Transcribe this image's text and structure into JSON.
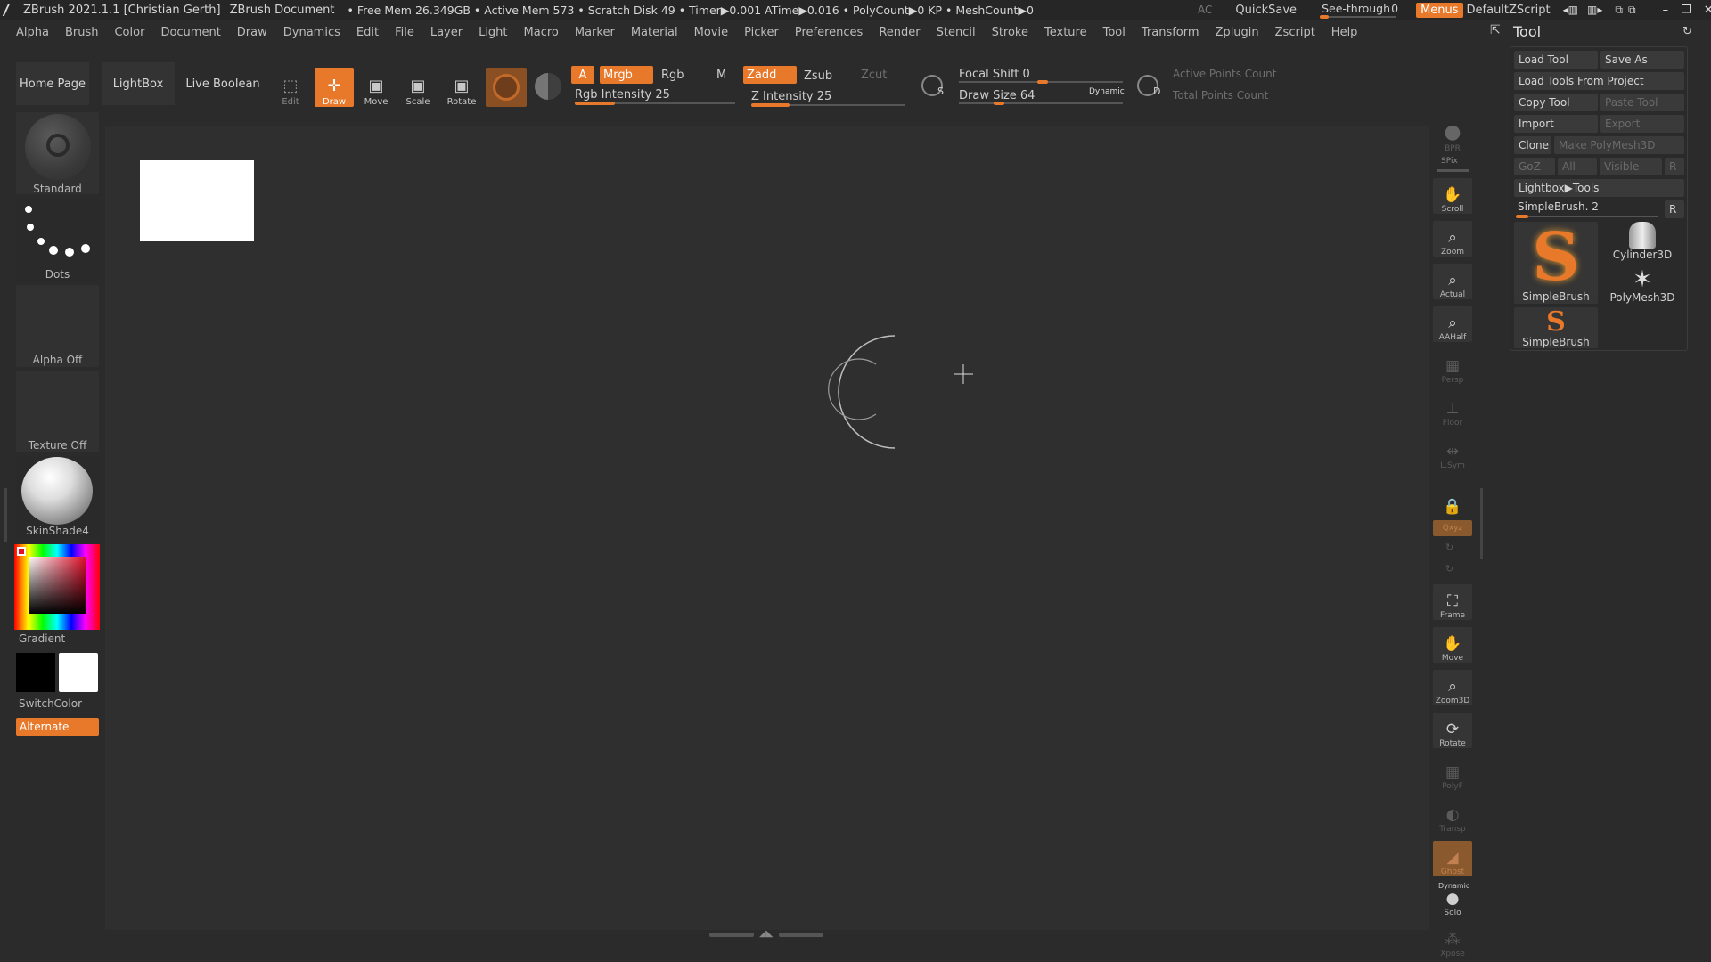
{
  "titlebar": {
    "app": "ZBrush 2021.1.1 [Christian Gerth]",
    "document": "ZBrush Document",
    "stats": "• Free Mem 26.349GB • Active Mem 573 • Scratch Disk 49 • Timer▶0.001 ATime▶0.016 • PolyCount▶0 KP • MeshCount▶0",
    "ac": "AC",
    "quicksave": "QuickSave",
    "see_through_label": "See-through",
    "see_through_value": "0",
    "see_through_level": 0,
    "menus": "Menus",
    "default_zscript": "DefaultZScript"
  },
  "menubar": {
    "items": [
      "Alpha",
      "Brush",
      "Color",
      "Document",
      "Draw",
      "Dynamics",
      "Edit",
      "File",
      "Layer",
      "Light",
      "Macro",
      "Marker",
      "Material",
      "Movie",
      "Picker",
      "Preferences",
      "Render",
      "Stencil",
      "Stroke",
      "Texture",
      "Tool",
      "Transform",
      "Zplugin",
      "Zscript",
      "Help"
    ]
  },
  "toolbar": {
    "home_page": "Home Page",
    "lightbox": "LightBox",
    "live_boolean": "Live Boolean",
    "edit": "Edit",
    "draw": "Draw",
    "move": "Move",
    "scale": "Scale",
    "rotate": "Rotate",
    "a": "A",
    "mrgb": "Mrgb",
    "rgb": "Rgb",
    "m": "M",
    "zadd": "Zadd",
    "zsub": "Zsub",
    "zcut": "Zcut",
    "rgb_intensity": "Rgb Intensity 25",
    "rgb_intensity_value": 25,
    "z_intensity": "Z Intensity 25",
    "z_intensity_value": 25,
    "focal_shift": "Focal Shift 0",
    "focal_shift_value": 0,
    "draw_size": "Draw Size 64",
    "draw_size_value": 64,
    "dynamic": "Dynamic",
    "active_points": "Active Points Count",
    "total_points": "Total Points Count",
    "s": "S",
    "d": "D"
  },
  "left_shelf": {
    "brush": "Standard",
    "stroke": "Dots",
    "alpha": "Alpha Off",
    "texture": "Texture Off",
    "material": "SkinShade4",
    "gradient": "Gradient",
    "switch_color": "SwitchColor",
    "alternate": "Alternate"
  },
  "right_shelf": {
    "bpr": "BPR",
    "spix": "SPix",
    "scroll": "Scroll",
    "zoom": "Zoom",
    "actual": "Actual",
    "aahalf": "AAHalf",
    "persp": "Persp",
    "floor": "Floor",
    "lsym": "L.Sym",
    "qxyz": "Qxyz",
    "frame": "Frame",
    "move": "Move",
    "zoom3d": "Zoom3D",
    "rotate": "Rotate",
    "polyf": "PolyF",
    "transp": "Transp",
    "ghost": "Ghost",
    "dynamic": "Dynamic",
    "solo": "Solo",
    "xpose": "Xpose"
  },
  "tool_panel": {
    "title": "Tool",
    "load_tool": "Load Tool",
    "save_as": "Save As",
    "load_from_project": "Load Tools From Project",
    "copy_tool": "Copy Tool",
    "paste_tool": "Paste Tool",
    "import": "Import",
    "export": "Export",
    "clone": "Clone",
    "make_polymesh": "Make PolyMesh3D",
    "goz": "GoZ",
    "all": "All",
    "visible": "Visible",
    "r": "R",
    "lightbox_tools": "Lightbox▶Tools",
    "current_tool": "SimpleBrush. 2",
    "thumbs": [
      "SimpleBrush",
      "Cylinder3D",
      "PolyMesh3D",
      "SimpleBrush"
    ]
  },
  "colors": {
    "accent": "#e8782a",
    "bg": "#2b2b2b",
    "canvas": "#2f2f2f"
  }
}
